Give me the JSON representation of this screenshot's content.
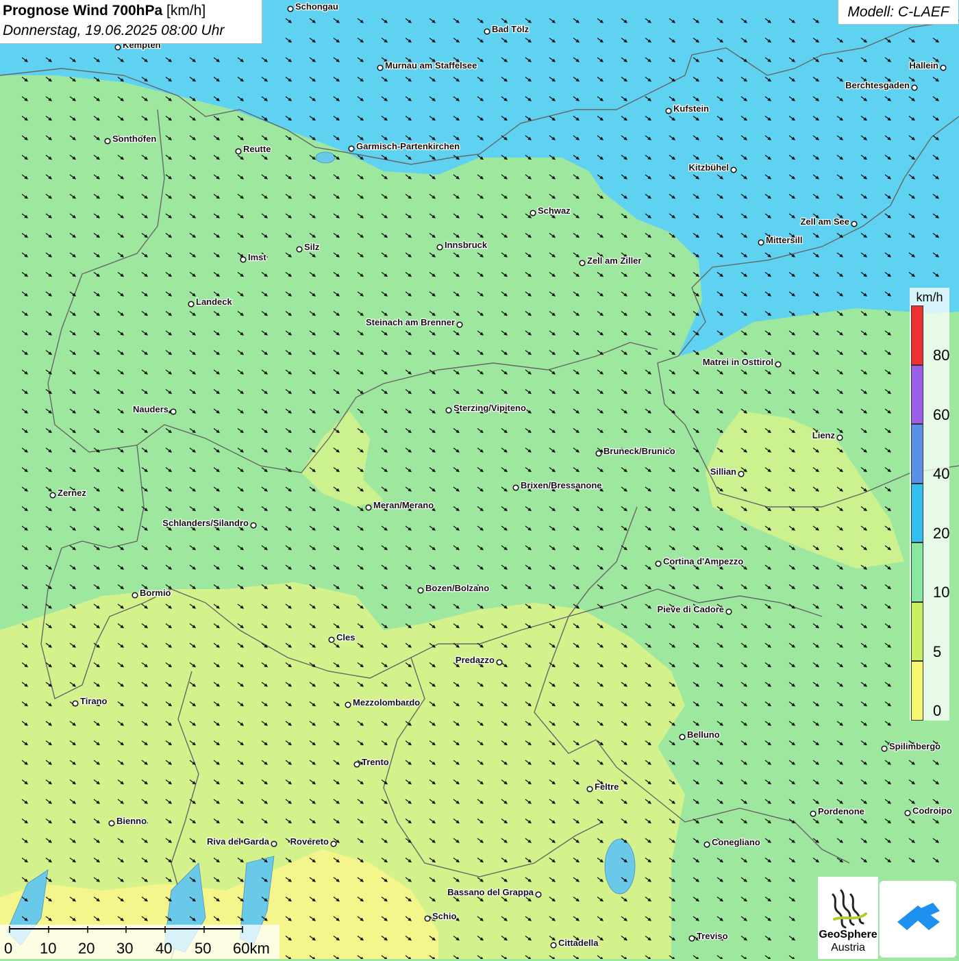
{
  "header": {
    "title_bold": "Prognose Wind 700hPa",
    "title_unit": "[km/h]",
    "subtitle": "Donnerstag, 19.06.2025 08:00 Uhr",
    "model": "Modell: C-LAEF"
  },
  "legend": {
    "unit": "km/h",
    "bins": [
      {
        "label": "80",
        "color": "#f03030"
      },
      {
        "label": "60",
        "color": "#9a60e8"
      },
      {
        "label": "40",
        "color": "#5b8fe8"
      },
      {
        "label": "20",
        "color": "#33bff0"
      },
      {
        "label": "10",
        "color": "#88e8a0"
      },
      {
        "label": "5",
        "color": "#c8f060"
      },
      {
        "label": "0",
        "color": "#f8f870"
      }
    ]
  },
  "scalebar": {
    "labels": [
      "0",
      "10",
      "20",
      "30",
      "40",
      "50",
      "60km"
    ]
  },
  "logos": {
    "geosphere_line1": "GeoSphere",
    "geosphere_line2": "Austria"
  },
  "colors": {
    "calm_yellow": "#f4f58a",
    "light_green": "#d4f28c",
    "green": "#9ee79e",
    "blue": "#5fd2f2",
    "arrow": "#111111",
    "border": "#666666"
  },
  "wind": {
    "direction_text": "from north-west (arrows pointing south-east)"
  },
  "cities": [
    {
      "name": "Schongau"
    },
    {
      "name": "Bad Tölz"
    },
    {
      "name": "Kempten"
    },
    {
      "name": "Murnau am Staffelsee"
    },
    {
      "name": "Hallein"
    },
    {
      "name": "Berchtesgaden"
    },
    {
      "name": "Kufstein"
    },
    {
      "name": "Sonthofen"
    },
    {
      "name": "Reutte"
    },
    {
      "name": "Garmisch-Partenkirchen"
    },
    {
      "name": "Kitzbühel"
    },
    {
      "name": "Schwaz"
    },
    {
      "name": "Zell am See"
    },
    {
      "name": "Mittersill"
    },
    {
      "name": "Innsbruck"
    },
    {
      "name": "Silz"
    },
    {
      "name": "Imst"
    },
    {
      "name": "Zell am Ziller"
    },
    {
      "name": "Landeck"
    },
    {
      "name": "Steinach am Brenner"
    },
    {
      "name": "Matrei in Osttirol"
    },
    {
      "name": "Nauders"
    },
    {
      "name": "Sterzing/Vipiteno"
    },
    {
      "name": "Lienz"
    },
    {
      "name": "Bruneck/Brunico"
    },
    {
      "name": "Sillian"
    },
    {
      "name": "Zernez"
    },
    {
      "name": "Brixen/Bressanone"
    },
    {
      "name": "Meran/Merano"
    },
    {
      "name": "Schlanders/Silandro"
    },
    {
      "name": "Cortina d'Ampezzo"
    },
    {
      "name": "Bozen/Bolzano"
    },
    {
      "name": "Bormio"
    },
    {
      "name": "Pieve di Cadore"
    },
    {
      "name": "Cles"
    },
    {
      "name": "Predazzo"
    },
    {
      "name": "Tirano"
    },
    {
      "name": "Mezzolombardo"
    },
    {
      "name": "Belluno"
    },
    {
      "name": "Spilimbergo"
    },
    {
      "name": "Trento"
    },
    {
      "name": "Feltre"
    },
    {
      "name": "Pordenone"
    },
    {
      "name": "Codroipo"
    },
    {
      "name": "Bienno"
    },
    {
      "name": "Riva del Garda"
    },
    {
      "name": "Rovereto"
    },
    {
      "name": "Conegliano"
    },
    {
      "name": "Bassano del Grappa"
    },
    {
      "name": "Schio"
    },
    {
      "name": "Treviso"
    },
    {
      "name": "Cittadella"
    }
  ]
}
